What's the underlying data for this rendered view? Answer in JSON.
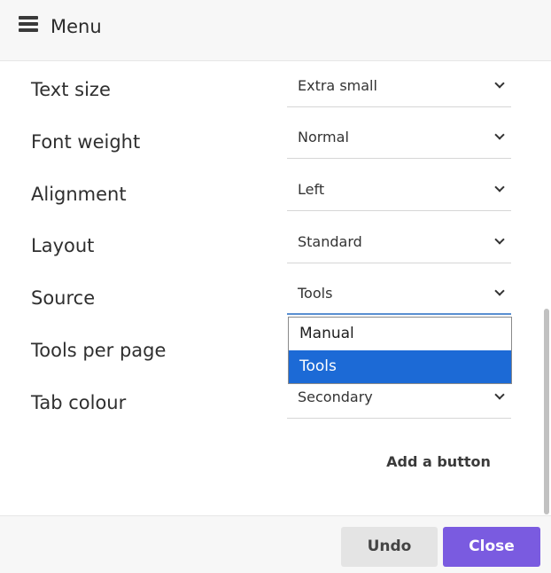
{
  "header": {
    "title": "Menu",
    "icon": "hamburger-icon"
  },
  "settings": [
    {
      "label": "Text size",
      "value": "Extra small"
    },
    {
      "label": "Font weight",
      "value": "Normal"
    },
    {
      "label": "Alignment",
      "value": "Left"
    },
    {
      "label": "Layout",
      "value": "Standard"
    },
    {
      "label": "Source",
      "value": "Tools"
    },
    {
      "label": "Tools per page",
      "value": ""
    },
    {
      "label": "Tab colour",
      "value": "Secondary"
    }
  ],
  "dropdown": {
    "options": [
      "Manual",
      "Tools"
    ],
    "selected": "Tools",
    "highlight_color": "#1c6ad6"
  },
  "add_button_label": "Add a button",
  "footer": {
    "undo_label": "Undo",
    "close_label": "Close",
    "close_color": "#7a5be0"
  }
}
